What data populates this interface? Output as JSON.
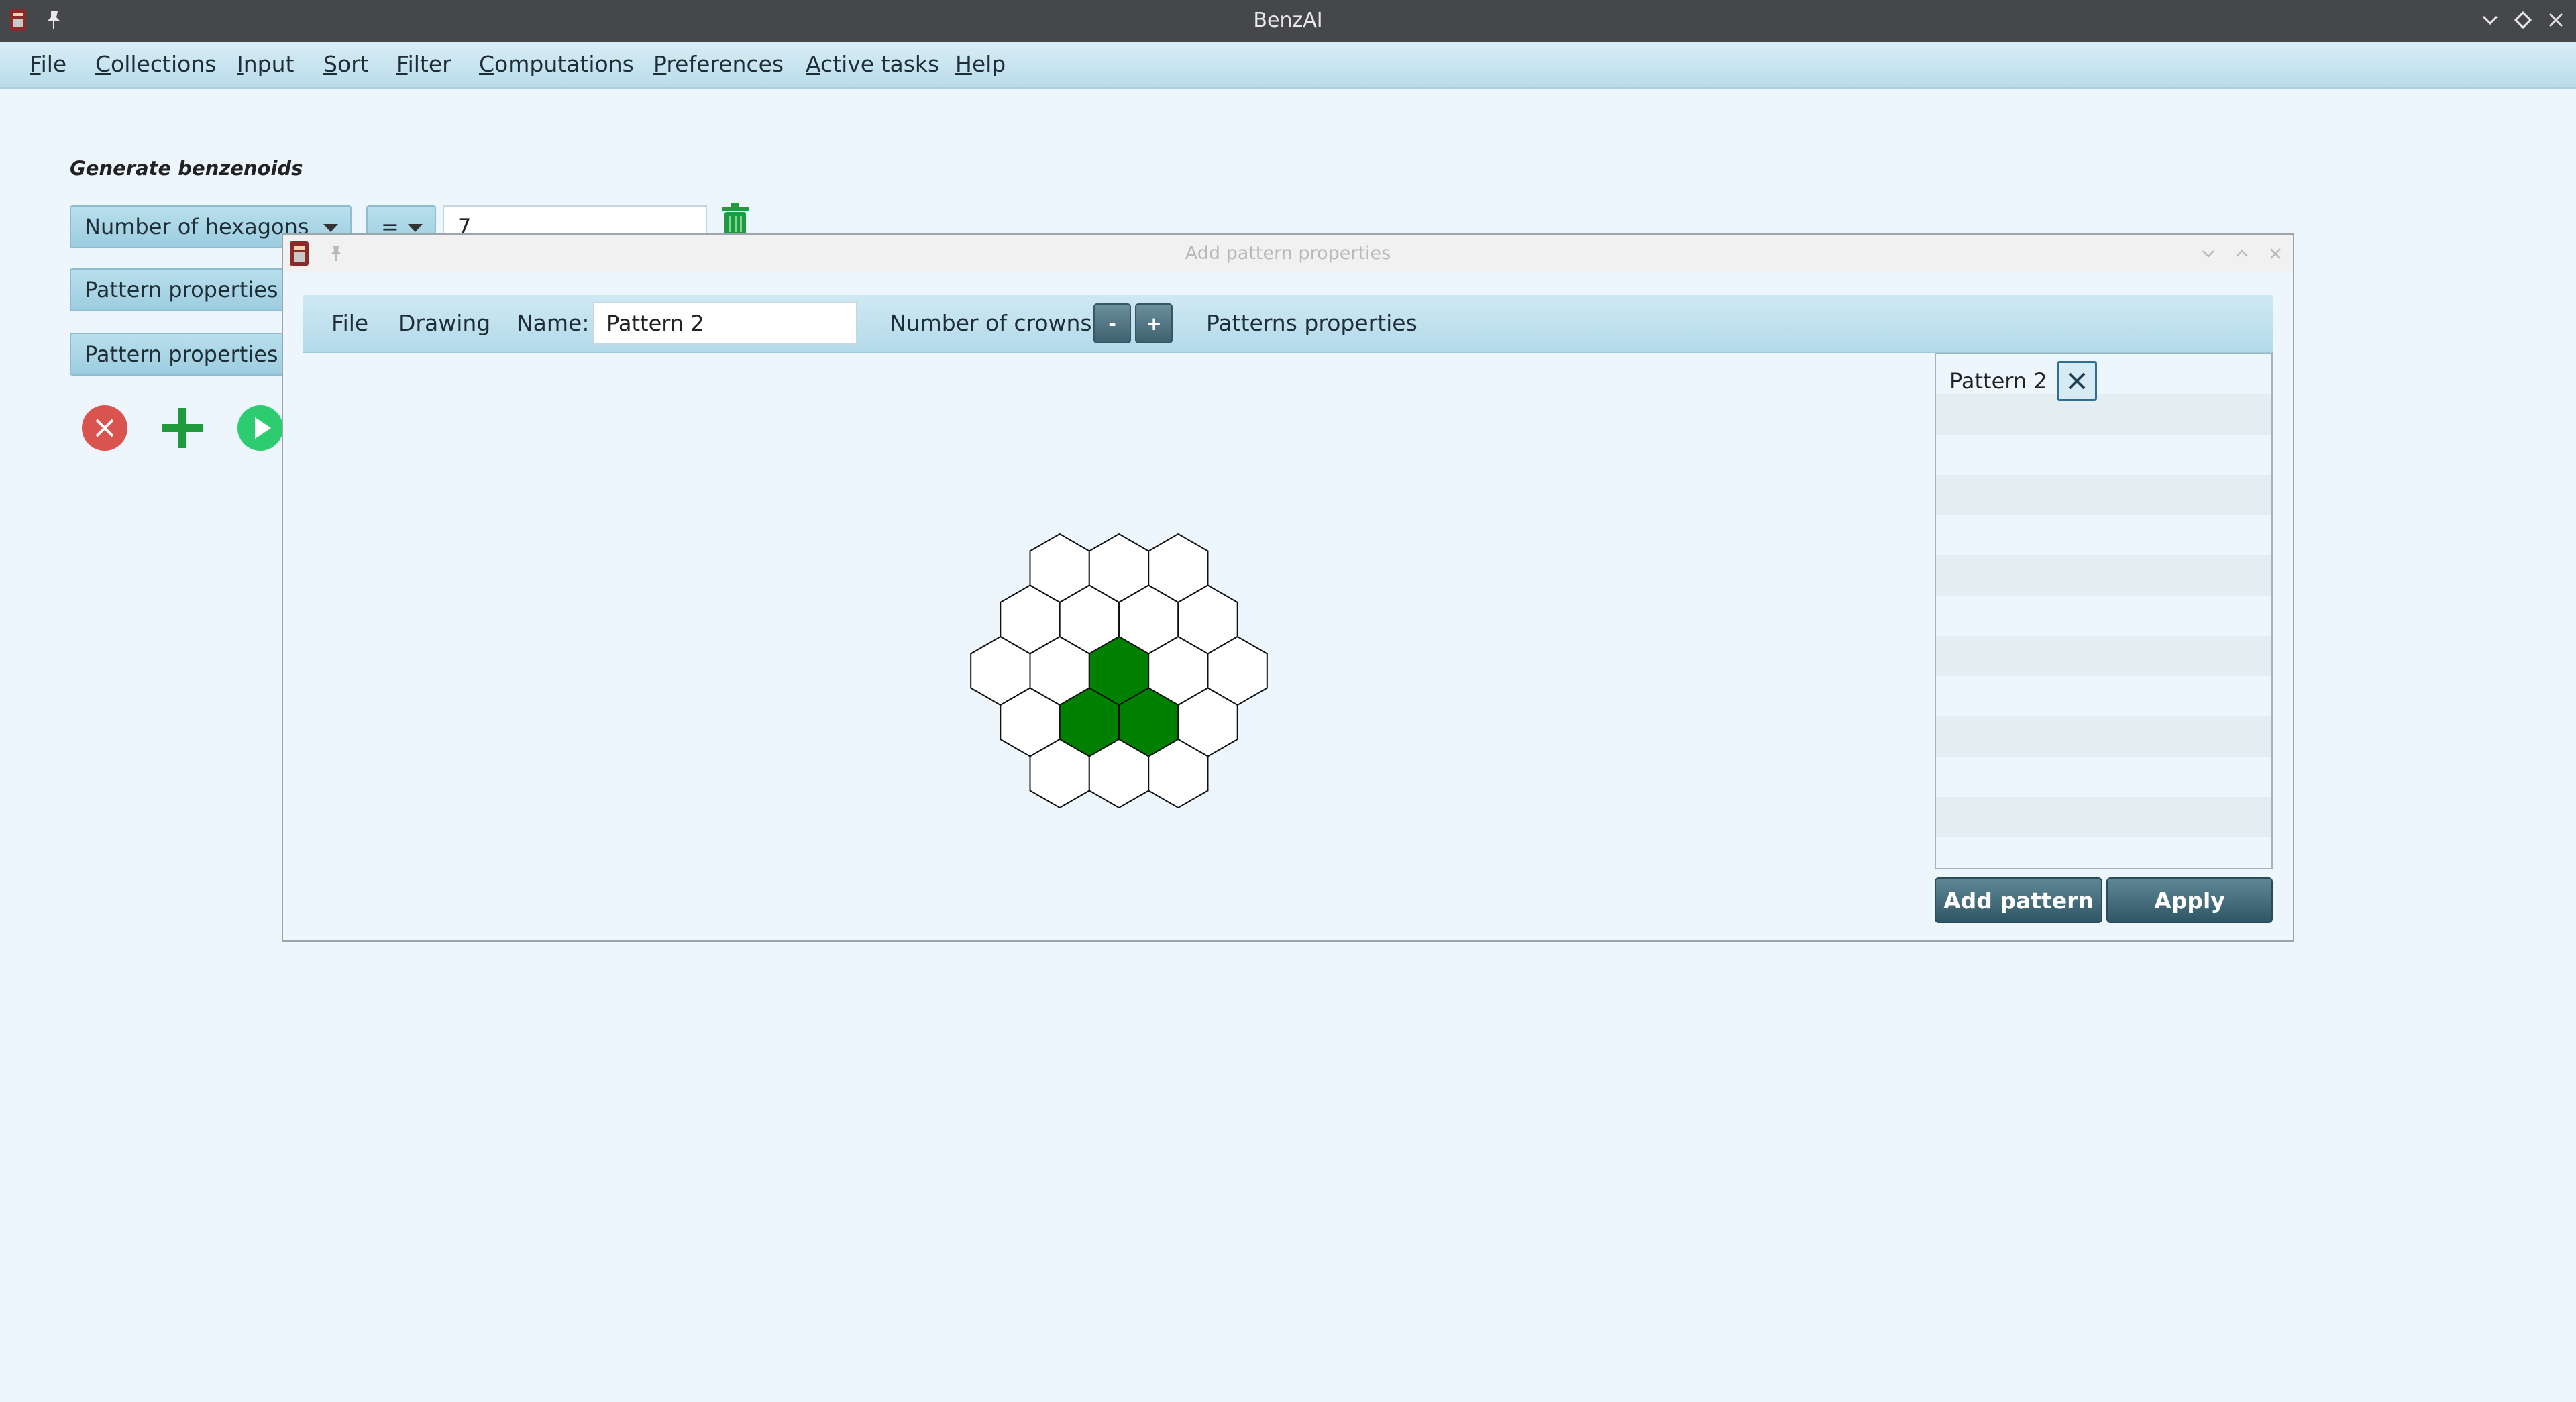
{
  "window": {
    "title": "BenzAI"
  },
  "menu": [
    "File",
    "Collections",
    "Input",
    "Sort",
    "Filter",
    "Computations",
    "Preferences",
    "Active tasks",
    "Help"
  ],
  "main": {
    "section_title": "Generate benzenoids",
    "criterion_combo": "Number of hexagons",
    "operator_combo": "=",
    "value_field": "7",
    "property_buttons": [
      "Pattern properties",
      "Pattern properties"
    ]
  },
  "dialog": {
    "title": "Add pattern properties",
    "toolbar": {
      "file": "File",
      "drawing": "Drawing",
      "name_label": "Name:",
      "name_value": "Pattern 2",
      "crowns_label": "Number of crowns:",
      "minus": "-",
      "plus": "+",
      "patterns_properties": "Patterns properties"
    },
    "pattern_list": [
      {
        "label": "Pattern 2"
      }
    ],
    "add_pattern_button": "Add pattern",
    "apply_button": "Apply"
  },
  "hex_grid": {
    "selected_color": "#008000",
    "empty_color": "#ffffff",
    "rows": [
      {
        "cells": 3,
        "selected": []
      },
      {
        "cells": 4,
        "selected": []
      },
      {
        "cells": 5,
        "selected": [
          2
        ]
      },
      {
        "cells": 4,
        "selected": [
          1,
          2
        ]
      },
      {
        "cells": 3,
        "selected": []
      }
    ]
  },
  "colors": {
    "accent_button": "#3e6170",
    "delete_icon": "#d9534f",
    "add_icon": "#1f9a3c",
    "run_icon": "#2ecc71"
  }
}
